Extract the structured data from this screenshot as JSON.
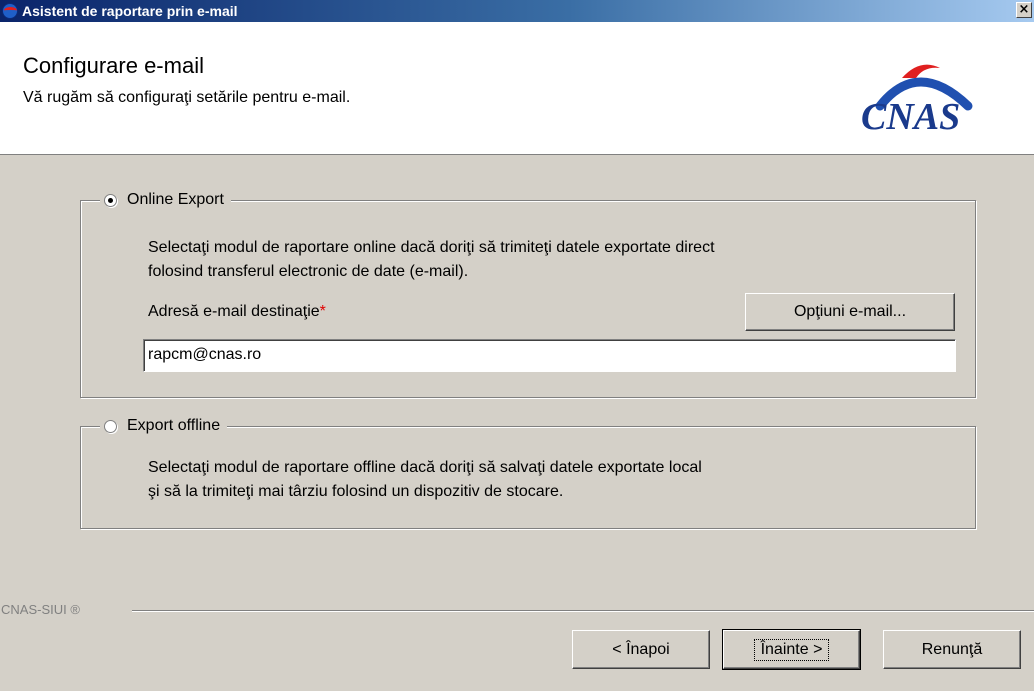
{
  "window": {
    "title": "Asistent de raportare prin e-mail",
    "close_glyph": "×",
    "icon": "cnas-app-icon"
  },
  "header": {
    "title": "Configurare e-mail",
    "subtitle": "Vă rugăm să configuraţi setările pentru e-mail.",
    "logo_text": "CNAS",
    "logo_colors": {
      "text": "#1a3a8c",
      "arc": "#2050b0",
      "wing": "#e02020"
    }
  },
  "online": {
    "label": "Online Export",
    "selected": true,
    "description_line1": "Selectaţi modul de raportare online dacă doriţi să trimiteţi datele exportate direct",
    "description_line2": "folosind transferul electronic de date (e-mail).",
    "email_label": "Adresă e-mail destinaţie",
    "required_mark": "*",
    "options_button": "Opţiuni e-mail...",
    "email_value": "rapcm@cnas.ro"
  },
  "offline": {
    "label": "Export offline",
    "selected": false,
    "description_line1": "Selectaţi modul de raportare offline dacă doriţi să salvaţi datele exportate local",
    "description_line2": "şi să la trimiteţi mai târziu folosind un dispozitiv de stocare."
  },
  "footer": {
    "brand": "CNAS-SIUI ®",
    "back_button": "< Înapoi",
    "next_button": "Înainte >",
    "cancel_button": "Renunţă"
  }
}
